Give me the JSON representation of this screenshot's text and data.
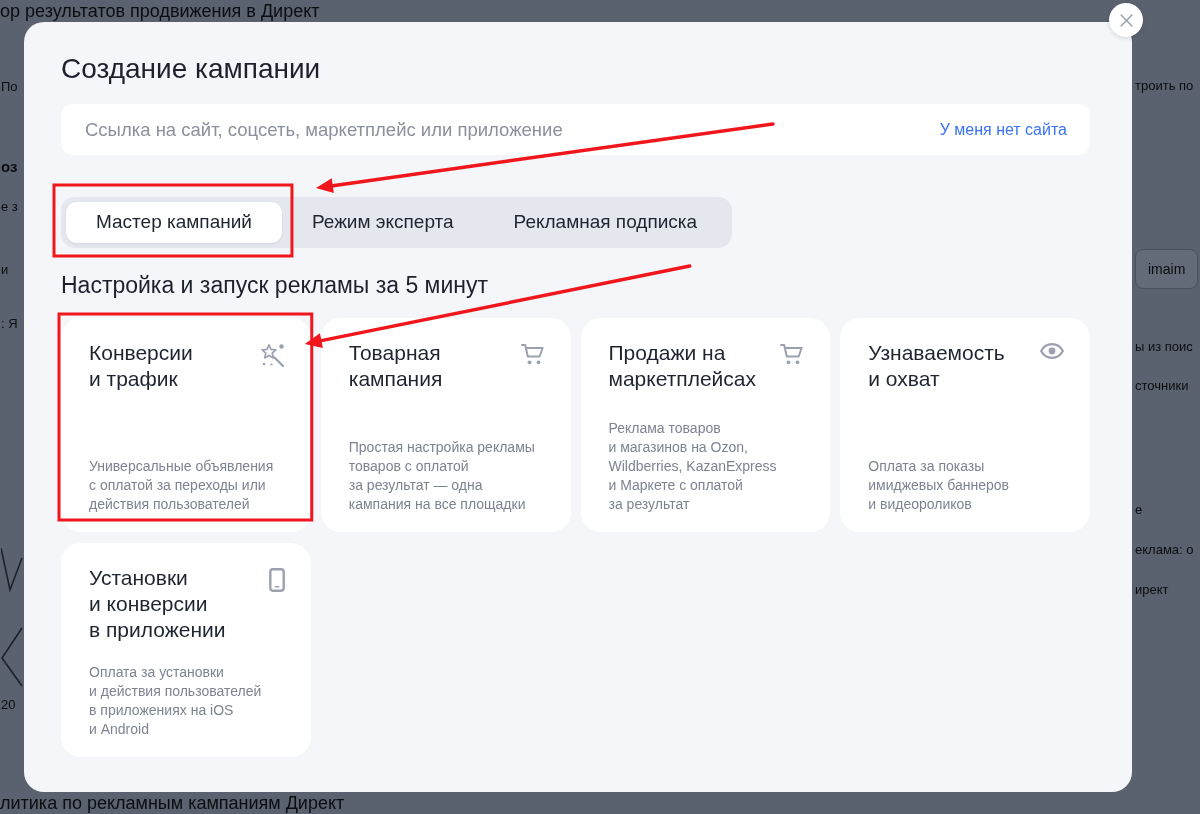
{
  "background_page": {
    "heading_top": "ор результатов продвижения в Директ",
    "left_fragments": [
      {
        "kind": "text",
        "text": "По"
      },
      {
        "kind": "heading",
        "text": "оз"
      },
      {
        "kind": "text",
        "text": "е з"
      },
      {
        "kind": "text",
        "text": "и"
      },
      {
        "kind": "text",
        "text": ": Я"
      },
      {
        "kind": "text",
        "text": "20"
      }
    ],
    "right_fragments": [
      {
        "kind": "text",
        "text": "троить по"
      },
      {
        "kind": "chip",
        "text": "imaim"
      },
      {
        "kind": "text",
        "text": "ы из поис"
      },
      {
        "kind": "text",
        "text": "сточники"
      },
      {
        "kind": "text",
        "text": "е"
      },
      {
        "kind": "text",
        "text": "еклама: о"
      },
      {
        "kind": "text",
        "text": "ирект"
      }
    ],
    "heading_bottom": "литика по рекламным кампаниям Директ"
  },
  "dialog": {
    "title": "Создание кампании",
    "url_field": {
      "placeholder": "Ссылка на сайт, соцсеть, маркетплейс или приложение",
      "link": "У меня нет сайта"
    },
    "tabs": [
      {
        "label": "Мастер кампаний",
        "selected": true,
        "highlighted": true
      },
      {
        "label": "Режим эксперта",
        "selected": false,
        "highlighted": false
      },
      {
        "label": "Рекламная подписка",
        "selected": false,
        "highlighted": false
      }
    ],
    "section_title": "Настройка и запуск рекламы за 5 минут",
    "cards": [
      {
        "kind": "conversion",
        "title": "Конверсии\nи трафик",
        "description": "Универсальные объявления\nс оплатой за переходы или\nдействия пользователей",
        "highlighted": true
      },
      {
        "kind": "product",
        "title": "Товарная\nкампания",
        "description": "Простая настройка рекламы\nтоваров с оплатой\nза результат — одна\nкампания на все площадки",
        "highlighted": false
      },
      {
        "kind": "marketplace",
        "title": "Продажи на\nмаркетплейсах",
        "description": "Реклама товаров\nи магазинов на Ozon,\nWildberries, KazanExpress\nи Маркете с оплатой\nза результат",
        "highlighted": false
      },
      {
        "kind": "reach",
        "title": "Узнаваемость\nи охват",
        "description": "Оплата за показы\nимиджевых баннеров\nи видеороликов",
        "highlighted": false
      },
      {
        "kind": "app",
        "title": "Установки\nи конверсии\nв приложении",
        "description": "Оплата за установки\nи действия пользователей\nв приложениях на iOS\nи Android",
        "highlighted": false
      }
    ]
  }
}
